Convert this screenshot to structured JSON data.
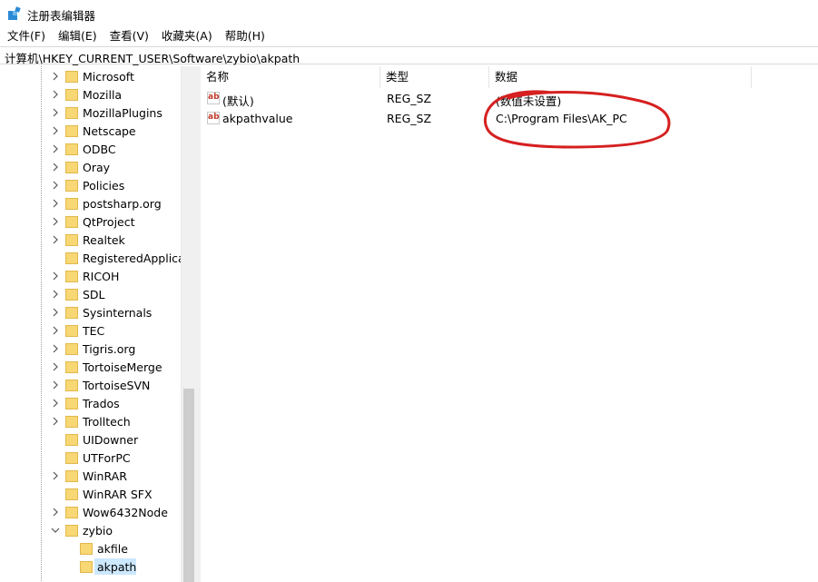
{
  "window": {
    "title": "注册表编辑器"
  },
  "menu": [
    "文件(F)",
    "编辑(E)",
    "查看(V)",
    "收藏夹(A)",
    "帮助(H)"
  ],
  "address": "计算机\\HKEY_CURRENT_USER\\Software\\zybio\\akpath",
  "tree": {
    "items": [
      {
        "label": "Microsoft",
        "expand": "collapsed"
      },
      {
        "label": "Mozilla",
        "expand": "collapsed"
      },
      {
        "label": "MozillaPlugins",
        "expand": "collapsed"
      },
      {
        "label": "Netscape",
        "expand": "collapsed"
      },
      {
        "label": "ODBC",
        "expand": "collapsed"
      },
      {
        "label": "Oray",
        "expand": "collapsed"
      },
      {
        "label": "Policies",
        "expand": "collapsed"
      },
      {
        "label": "postsharp.org",
        "expand": "collapsed"
      },
      {
        "label": "QtProject",
        "expand": "collapsed"
      },
      {
        "label": "Realtek",
        "expand": "collapsed"
      },
      {
        "label": "RegisteredApplicat",
        "expand": "none"
      },
      {
        "label": "RICOH",
        "expand": "collapsed"
      },
      {
        "label": "SDL",
        "expand": "collapsed"
      },
      {
        "label": "Sysinternals",
        "expand": "collapsed"
      },
      {
        "label": "TEC",
        "expand": "collapsed"
      },
      {
        "label": "Tigris.org",
        "expand": "collapsed"
      },
      {
        "label": "TortoiseMerge",
        "expand": "collapsed"
      },
      {
        "label": "TortoiseSVN",
        "expand": "collapsed"
      },
      {
        "label": "Trados",
        "expand": "collapsed"
      },
      {
        "label": "Trolltech",
        "expand": "collapsed"
      },
      {
        "label": "UIDowner",
        "expand": "none"
      },
      {
        "label": "UTForPC",
        "expand": "none"
      },
      {
        "label": "WinRAR",
        "expand": "collapsed"
      },
      {
        "label": "WinRAR SFX",
        "expand": "none"
      },
      {
        "label": "Wow6432Node",
        "expand": "collapsed"
      },
      {
        "label": "zybio",
        "expand": "expanded"
      },
      {
        "label": "akfile",
        "expand": "child"
      },
      {
        "label": "akpath",
        "expand": "child",
        "selected": true
      }
    ]
  },
  "list": {
    "columns": [
      "名称",
      "类型",
      "数据"
    ],
    "rows": [
      {
        "name": "(默认)",
        "type": "REG_SZ",
        "data": "(数值未设置)"
      },
      {
        "name": "akpathvalue",
        "type": "REG_SZ",
        "data": "C:\\Program Files\\AK_PC"
      }
    ]
  },
  "colors": {
    "annotation": "#d62020",
    "selection": "#cce8ff",
    "folder": "#f8d775"
  }
}
